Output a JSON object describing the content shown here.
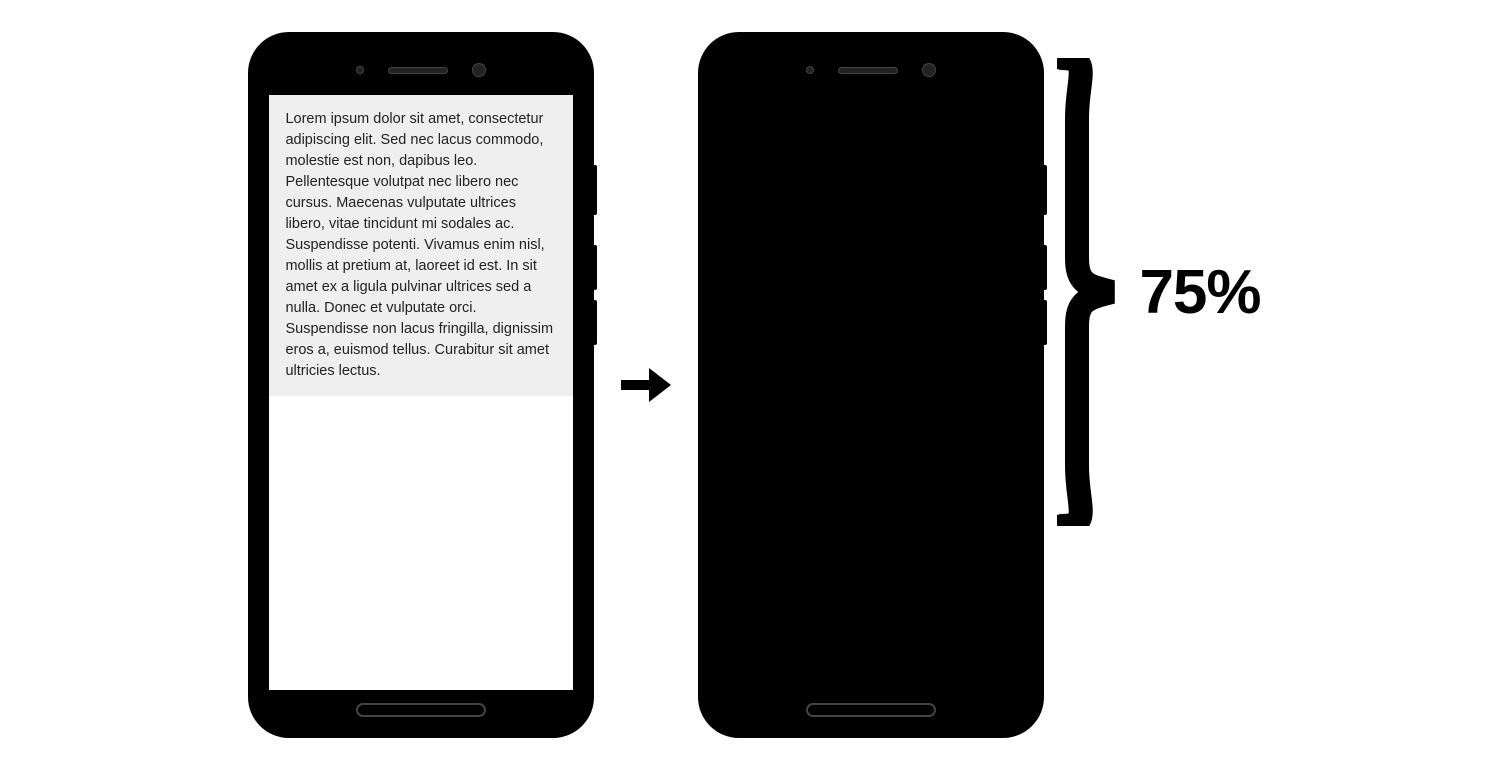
{
  "diagram": {
    "lorem_text": "Lorem ipsum dolor sit amet, consectetur adipiscing elit. Sed nec lacus commodo, molestie est non, dapibus leo. Pellentesque volutpat nec libero nec cursus. Maecenas vulputate ultrices libero, vitae tincidunt mi sodales ac. Suspendisse potenti. Vivamus enim nisl, mollis at pretium at, laoreet id est. In sit amet ex a ligula pulvinar ultrices sed a nulla. Donec et vulputate orci. Suspendisse non lacus fringilla, dignissim eros a, euismod tellus. Curabitur sit amet ultricies lectus.",
    "percent_label": "75%",
    "highlight_color": "#d9472b",
    "highlight_fraction": 0.75,
    "arrow_direction": "right"
  }
}
